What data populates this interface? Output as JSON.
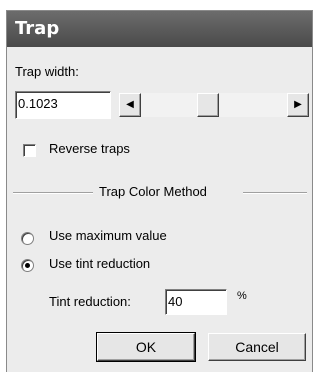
{
  "window": {
    "title": "Trap"
  },
  "trap_width": {
    "label": "Trap width:",
    "value": "0.1023",
    "slider_fraction": 0.45
  },
  "reverse_traps": {
    "label": "Reverse traps",
    "checked": false
  },
  "group": {
    "title": "Trap Color Method"
  },
  "methods": [
    {
      "label": "Use maximum value",
      "selected": false
    },
    {
      "label": "Use tint reduction",
      "selected": true
    }
  ],
  "tint": {
    "label": "Tint reduction:",
    "value": "40",
    "unit": "%"
  },
  "buttons": {
    "ok": "OK",
    "cancel": "Cancel"
  },
  "icons": {
    "scroll_left": "arrow-left-icon",
    "scroll_right": "arrow-right-icon"
  },
  "colors": {
    "titlebar": "#555555",
    "dialog_bg": "#ececec"
  }
}
